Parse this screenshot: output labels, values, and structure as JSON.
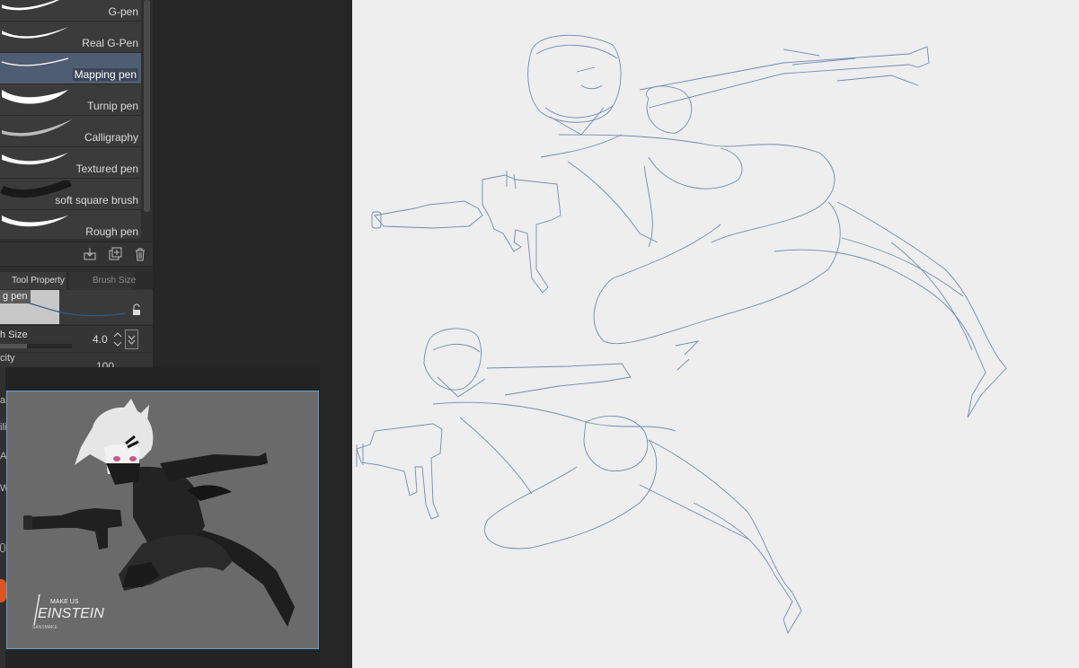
{
  "brushes": [
    {
      "label": "G-pen",
      "selected": false
    },
    {
      "label": "Real G-Pen",
      "selected": false
    },
    {
      "label": "Mapping pen",
      "selected": true
    },
    {
      "label": "Turnip pen",
      "selected": false
    },
    {
      "label": "Calligraphy",
      "selected": false
    },
    {
      "label": "Textured pen",
      "selected": false
    },
    {
      "label": "soft square brush",
      "selected": false
    },
    {
      "label": "Rough pen",
      "selected": false
    }
  ],
  "tabs": {
    "tool_property": "Tool Property",
    "brush_size": "Brush Size"
  },
  "tool_property": {
    "preview_label": "g pen",
    "size_label": "h Size",
    "size_value": "4.0",
    "opacity_label": "city",
    "opacity_value": "100"
  },
  "side_fragments": [
    "al",
    "ili",
    "Ac",
    "W"
  ],
  "navigator": {
    "logo_small": "MAKE US",
    "logo_main": "EINSTEIN",
    "logo_sub": "SANSMAKE"
  },
  "colors": {
    "selected_brush": "#4f5d73",
    "navigator_border": "#5f9fd8",
    "sketch_stroke": "#5b7aa8",
    "accent_orange": "#e0541e",
    "canvas_bg": "#eeeeee"
  }
}
